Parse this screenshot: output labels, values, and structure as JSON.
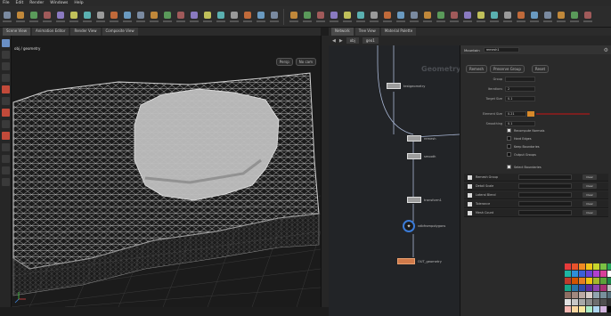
{
  "menu": [
    "File",
    "Edit",
    "Render",
    "Windows",
    "Help"
  ],
  "viewport": {
    "tabs": [
      "Scene View",
      "Animation Editor",
      "Render View",
      "Composite View"
    ],
    "title": "obj / geometry",
    "buttons": [
      "Persp",
      "No cam"
    ]
  },
  "network": {
    "tabs": [
      "Network",
      "Tree View",
      "Material Palette"
    ],
    "path": [
      "obj",
      "geo1"
    ],
    "context_label": "Geometry",
    "nodes": [
      {
        "name": "testgeometry"
      },
      {
        "name": "remesh"
      },
      {
        "name": "smooth"
      },
      {
        "name": "transform1"
      },
      {
        "name": "vdbfrompolygons"
      },
      {
        "name": "OUT_geometry"
      }
    ]
  },
  "params": {
    "node_type": "Mountain",
    "node_name": "remesh1",
    "buttons": [
      "Remesh",
      "Preserve Group",
      "Reset"
    ],
    "fields": [
      {
        "label": "Group",
        "value": ""
      },
      {
        "label": "Iterations",
        "value": "2"
      },
      {
        "label": "Target Size",
        "value": "0.1"
      },
      {
        "label": "Element Size",
        "value": "0.21"
      },
      {
        "label": "Smoothing",
        "value": "0.1"
      }
    ],
    "checks": [
      {
        "label": "Recompute Normals",
        "on": true
      },
      {
        "label": "Hard Edges",
        "on": false
      },
      {
        "label": "Keep Boundaries",
        "on": false
      },
      {
        "label": "Output Groups",
        "on": false
      }
    ],
    "bottom_check": {
      "label": "Select Boundaries",
      "on": true
    },
    "multiparm": [
      {
        "label": "Remesh Group"
      },
      {
        "label": "Detail Scale"
      },
      {
        "label": "Lateral Blend"
      },
      {
        "label": "Tolerance"
      },
      {
        "label": "Mesh Count"
      }
    ],
    "mp_button": "Clear"
  },
  "palette_colors": [
    "#e63b3b",
    "#e8522c",
    "#f08a23",
    "#f0c419",
    "#c8d62c",
    "#7bc043",
    "#26a65b",
    "#1fb5a3",
    "#2f8fd8",
    "#3b5fd8",
    "#6a42d4",
    "#b13fd0",
    "#d8409a",
    "#ffffff",
    "#c0392b",
    "#d35400",
    "#e67e22",
    "#f1c40f",
    "#a4b92a",
    "#5ca33a",
    "#1e8449",
    "#17a589",
    "#2874a6",
    "#2e4aa8",
    "#5b2c9f",
    "#8e44ad",
    "#a93273",
    "#bfbfbf",
    "#8d6e63",
    "#a1887f",
    "#bcaaa4",
    "#d7ccc8",
    "#90a4ae",
    "#78909c",
    "#546e7a",
    "#e1e1e1",
    "#c8c8c8",
    "#a8a8a8",
    "#8a8a8a",
    "#6e6e6e",
    "#505050",
    "#333333",
    "#f5b7b1",
    "#fad7a0",
    "#f9e79f",
    "#abebc6",
    "#aed6f1",
    "#d2b4de",
    "#000000"
  ]
}
